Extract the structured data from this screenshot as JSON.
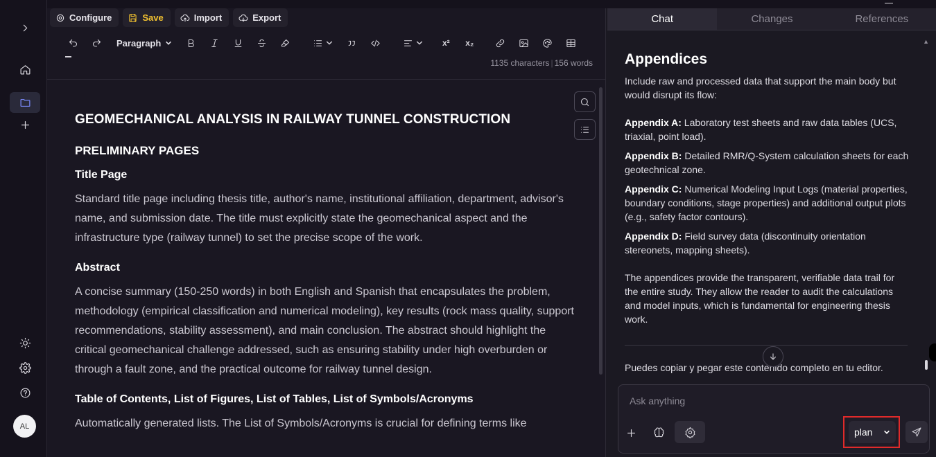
{
  "toolbar": {
    "configure_label": "Configure",
    "save_label": "Save",
    "import_label": "Import",
    "export_label": "Export",
    "paragraph_style": "Paragraph",
    "superscript": "x²",
    "subscript": "x₂",
    "characters": "1135 characters",
    "words": "156 words"
  },
  "user": {
    "initials": "AL"
  },
  "doc": {
    "title": "GEOMECHANICAL ANALYSIS IN RAILWAY TUNNEL CONSTRUCTION",
    "section1": "PRELIMINARY PAGES",
    "h_title_page": "Title Page",
    "p_title_page": "Standard title page including thesis title, author's name, institutional affiliation, department, advisor's name, and submission date. The title must explicitly state the geomechanical aspect and the infrastructure type (railway tunnel) to set the precise scope of the work.",
    "h_abstract": "Abstract",
    "p_abstract": "A concise summary (150-250 words) in both English and Spanish that encapsulates the problem, methodology (empirical classification and numerical modeling), key results (rock mass quality, support recommendations, stability assessment), and main conclusion. The abstract should highlight the critical geomechanical challenge addressed, such as ensuring stability under high overburden or through a fault zone, and the practical outcome for railway tunnel design.",
    "h_toc": "Table of Contents, List of Figures, List of Tables, List of Symbols/Acronyms",
    "p_toc": "Automatically generated lists. The List of Symbols/Acronyms is crucial for defining terms like"
  },
  "panel": {
    "tabs": [
      "Chat",
      "Changes",
      "References"
    ],
    "heading": "Appendices",
    "intro": "Include raw and processed data that support the main body but would disrupt its flow:",
    "appendices": [
      {
        "label": "Appendix A:",
        "text": " Laboratory test sheets and raw data tables (UCS, triaxial, point load)."
      },
      {
        "label": "Appendix B:",
        "text": " Detailed RMR/Q-System calculation sheets for each geotechnical zone."
      },
      {
        "label": "Appendix C:",
        "text": " Numerical Modeling Input Logs (material properties, boundary conditions, stage properties) and additional output plots (e.g., safety factor contours)."
      },
      {
        "label": "Appendix D:",
        "text": " Field survey data (discontinuity orientation stereonets, mapping sheets)."
      }
    ],
    "closing": "The appendices provide the transparent, verifiable data trail for the entire study. They allow the reader to audit the calculations and model inputs, which is fundamental for engineering thesis work.",
    "spanish_note": "Puedes copiar y pegar este contenido completo en tu editor.",
    "composer_placeholder": "Ask anything",
    "mode": "plan"
  }
}
